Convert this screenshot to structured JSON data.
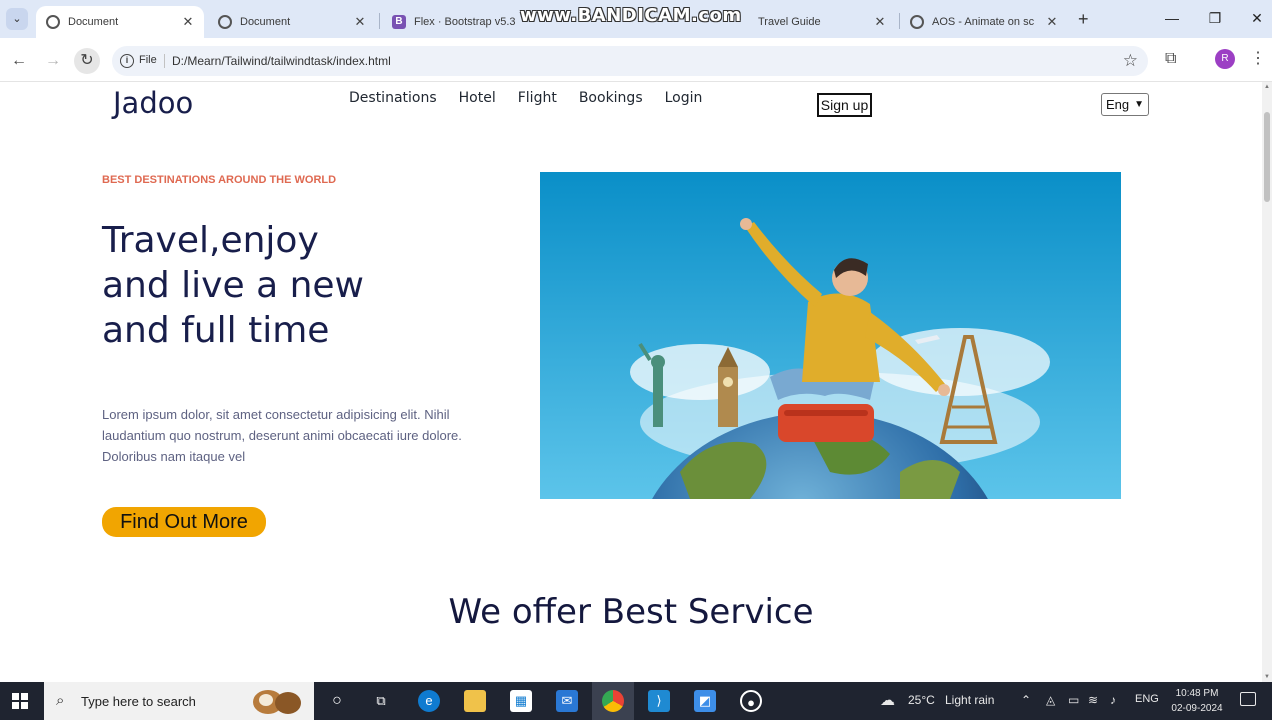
{
  "browser": {
    "tabs": [
      {
        "title": "Document",
        "active": true,
        "icon": "globe-icon"
      },
      {
        "title": "Document",
        "active": false,
        "icon": "globe-icon"
      },
      {
        "title": "Flex · Bootstrap v5.3",
        "active": false,
        "icon": "bootstrap-icon"
      },
      {
        "title": "Travel Guide",
        "active": false,
        "icon": "globe-icon"
      },
      {
        "title": "AOS - Animate on sc",
        "active": false,
        "icon": "globe-icon"
      }
    ],
    "watermark": "www.BANDICAM.com",
    "bootstrap_letter": "B",
    "file_label": "File",
    "url": "D:/Mearn/Tailwind/tailwindtask/index.html",
    "profile_initial": "R"
  },
  "page": {
    "brand": "Jadoo",
    "nav": [
      "Destinations",
      "Hotel",
      "Flight",
      "Bookings",
      "Login"
    ],
    "signup": "Sign up",
    "language": "Eng",
    "tagline": "BEST DESTINATIONS AROUND THE WORLD",
    "hero_title_lines": [
      "Travel,enjoy",
      "and live a new",
      "and full time"
    ],
    "hero_text": "Lorem ipsum dolor, sit amet consectetur adipisicing elit. Nihil laudantium quo nostrum, deserunt animi obcaecati iure dolore. Doloribus nam itaque vel",
    "cta": "Find Out More",
    "service_title": "We offer Best Service"
  },
  "taskbar": {
    "search_placeholder": "Type here to search",
    "weather_temp": "25°C",
    "weather_desc": "Light rain",
    "language": "ENG",
    "time": "10:48 PM",
    "date": "02-09-2024"
  },
  "colors": {
    "accent_orange": "#f1a501",
    "tagline_red": "#df6951",
    "brand_navy": "#181e4b"
  }
}
